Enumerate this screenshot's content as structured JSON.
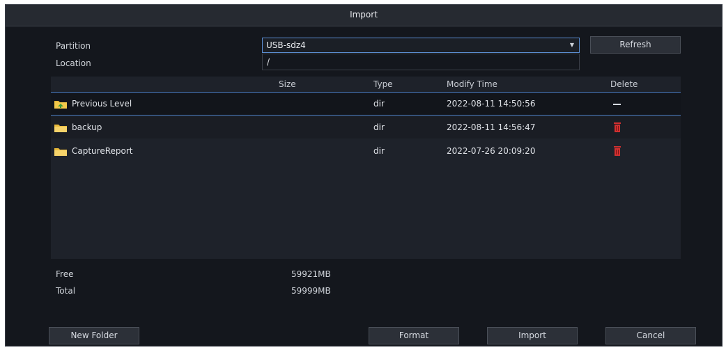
{
  "dialog": {
    "title": "Import"
  },
  "form": {
    "partition_label": "Partition",
    "partition_value": "USB-sdz4",
    "location_label": "Location",
    "location_value": "/",
    "refresh_label": "Refresh"
  },
  "table": {
    "columns": {
      "size": "Size",
      "type": "Type",
      "modify_time": "Modify Time",
      "delete": "Delete"
    },
    "rows": [
      {
        "name": "Previous Level",
        "size": "",
        "type": "dir",
        "modify_time": "2022-08-11 14:50:56",
        "delete_icon": "dash-icon"
      },
      {
        "name": "backup",
        "size": "",
        "type": "dir",
        "modify_time": "2022-08-11 14:56:47",
        "delete_icon": "trash-icon"
      },
      {
        "name": "CaptureReport",
        "size": "",
        "type": "dir",
        "modify_time": "2022-07-26 20:09:20",
        "delete_icon": "trash-icon"
      }
    ]
  },
  "storage": {
    "free_label": "Free",
    "free_value": "59921MB",
    "total_label": "Total",
    "total_value": "59999MB"
  },
  "buttons": {
    "new_folder": "New Folder",
    "format": "Format",
    "import": "Import",
    "cancel": "Cancel"
  },
  "colors": {
    "accent": "#4a7ec4",
    "background": "#14171d",
    "delete_red": "#d03030",
    "folder": "#f0c040"
  }
}
